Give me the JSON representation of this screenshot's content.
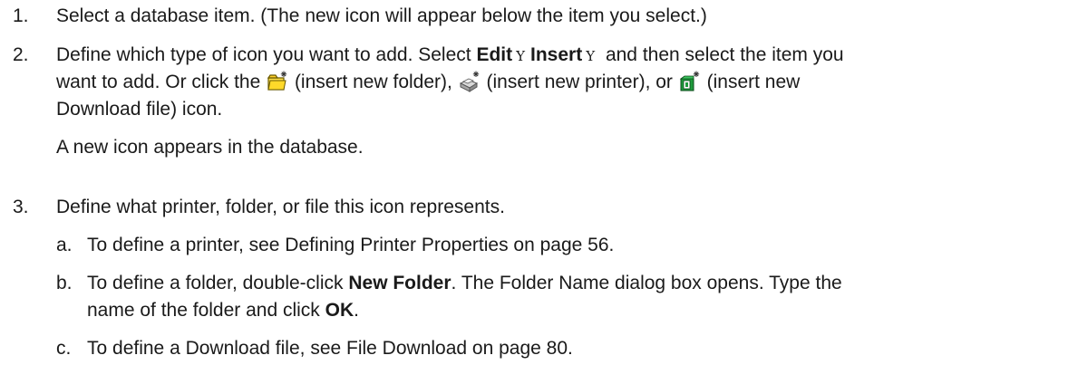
{
  "steps": [
    {
      "number": "1.",
      "text": "Select a database item. (The new icon will appear below the item you select.)"
    },
    {
      "number": "2.",
      "line1_pre": "Define which type of icon you want to add. Select ",
      "edit": "Edit",
      "arrow": "Y",
      "insert": "Insert",
      "line1_post": " and then select the item you",
      "line2_pre": "want to add. Or click the ",
      "folder_desc": " (insert new folder), ",
      "printer_desc": " (insert new printer), or ",
      "download_desc": " (insert new",
      "line3": "Download file) icon.",
      "result": "A new icon appears in the database."
    },
    {
      "number": "3.",
      "text": "Define what printer, folder, or file this icon represents.",
      "substeps": [
        {
          "letter": "a.",
          "text": "To define a printer, see Defining Printer Properties on page 56."
        },
        {
          "letter": "b.",
          "line1_pre": "To define a folder, double-click ",
          "new_folder": "New Folder",
          "line1_post": ". The Folder Name dialog box opens. Type the",
          "line2_pre": "name of the folder and click ",
          "ok": "OK",
          "line2_post": "."
        },
        {
          "letter": "c.",
          "text": "To define a Download file, see File Download on page 80."
        }
      ]
    }
  ],
  "icons": {
    "folder": "insert-folder-icon",
    "printer": "insert-printer-icon",
    "download": "insert-download-icon"
  }
}
